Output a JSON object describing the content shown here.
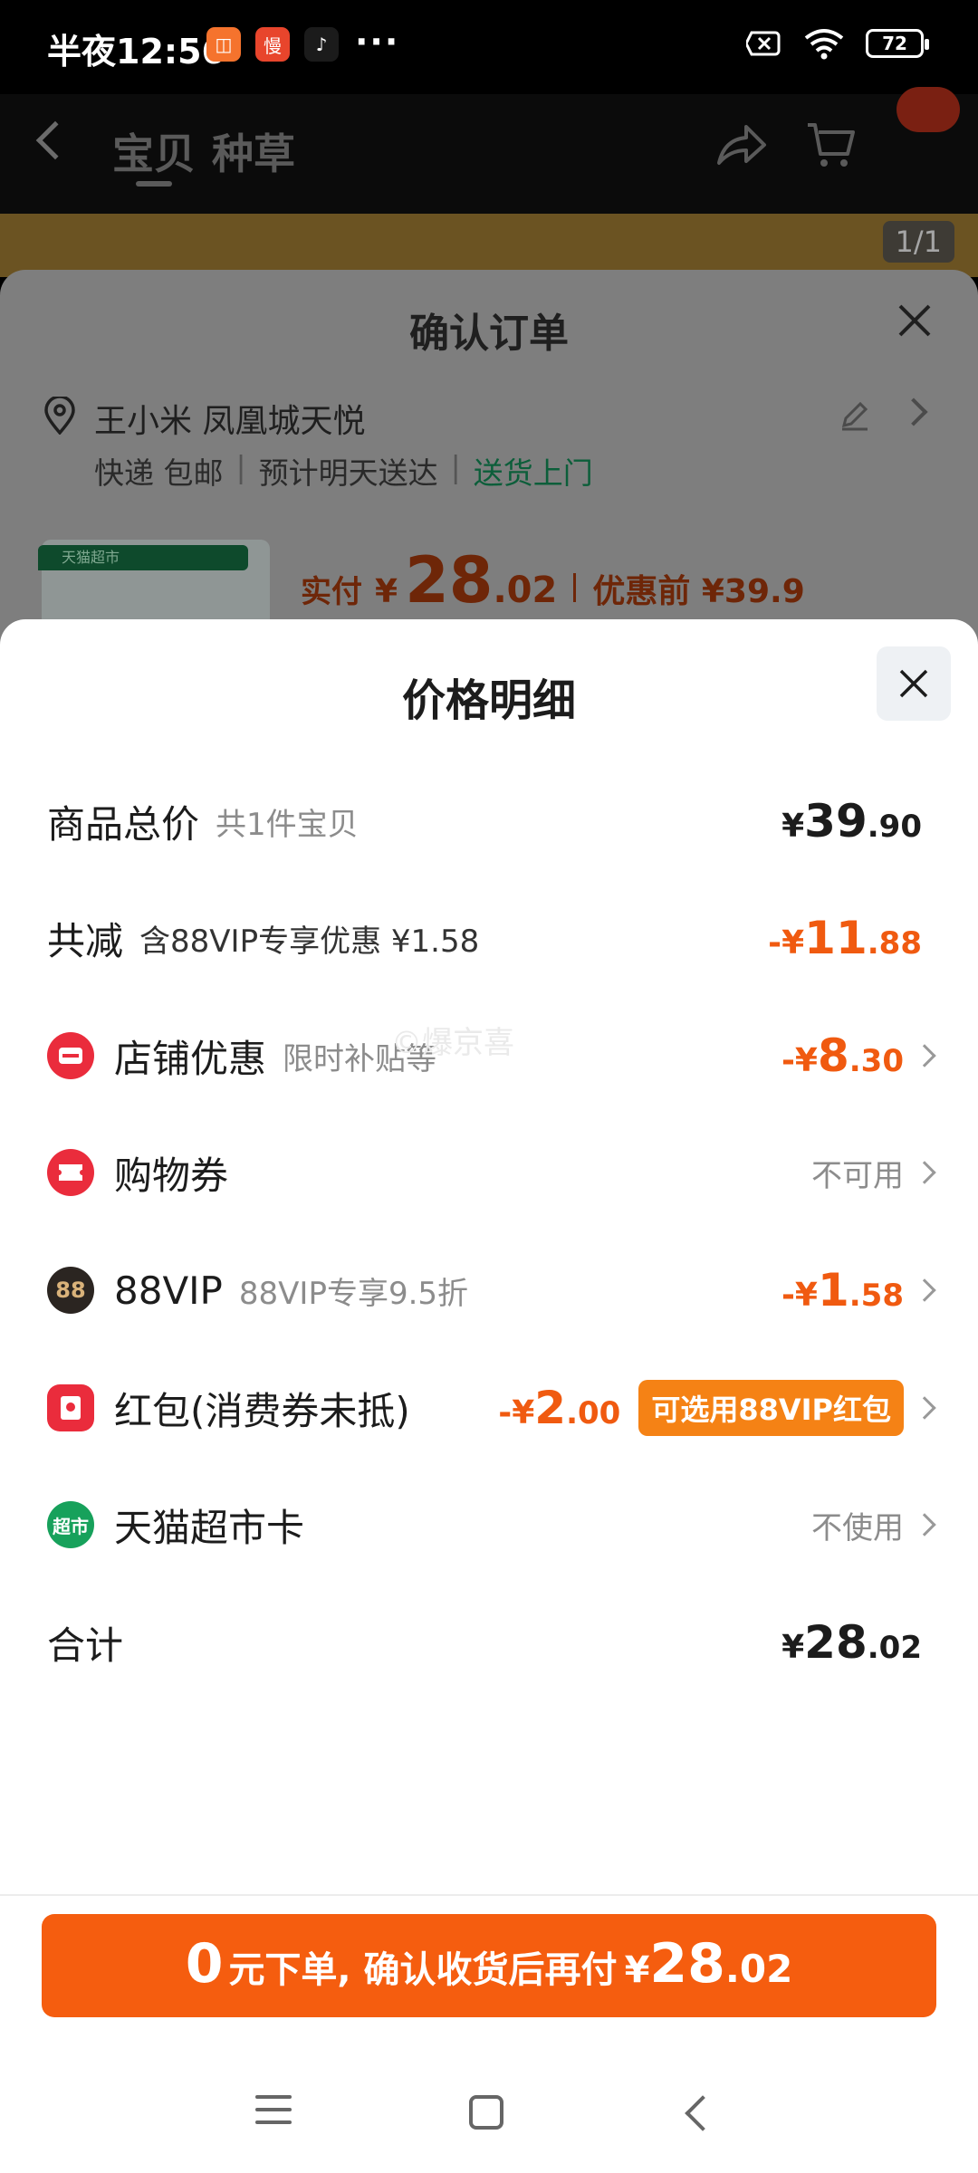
{
  "status_bar": {
    "time": "半夜12:56",
    "apps": [
      {
        "icon": "taobao-icon",
        "glyph": "◫",
        "color": "#f5732d"
      },
      {
        "icon": "xianyu-icon",
        "glyph": "慢",
        "color": "#e8452c"
      },
      {
        "icon": "douyin-icon",
        "glyph": "♪",
        "color": "#1b1b1b"
      }
    ],
    "more": "···",
    "battery": "72"
  },
  "background_page": {
    "tabs": [
      "宝贝",
      "种草"
    ],
    "page_indicator": "1/1",
    "order_sheet": {
      "title": "确认订单",
      "address": "王小米 凤凰城天悦",
      "shipping": [
        "快递 包邮",
        "预计明天送达",
        "送货上门"
      ],
      "product_tag": "天猫超市",
      "pay_label": "实付",
      "pay_currency": "¥",
      "pay_int": "28",
      "pay_dec": ".02",
      "pay_before": "优惠前 ¥39.9"
    }
  },
  "price_detail": {
    "title": "价格明细",
    "rows": [
      {
        "title": "商品总价",
        "sub": "共1件宝贝",
        "amount": {
          "sign": "¥",
          "int": "39",
          "dec": ".90"
        }
      },
      {
        "title": "共减",
        "sub": "含88VIP专享优惠 ¥1.58",
        "amount": {
          "sign": "-¥",
          "int": "11",
          "dec": ".88"
        }
      },
      {
        "title": "店铺优惠",
        "sub": "限时补贴等",
        "amount": {
          "sign": "-¥",
          "int": "8",
          "dec": ".30"
        }
      },
      {
        "title": "购物券",
        "value": "不可用"
      },
      {
        "title": "88VIP",
        "sub": "88VIP专享9.5折",
        "amount": {
          "sign": "-¥",
          "int": "1",
          "dec": ".58"
        }
      },
      {
        "title": "红包(消费券未抵)",
        "amount": {
          "sign": "-¥",
          "int": "2",
          "dec": ".00"
        },
        "badge": "可选用88VIP红包"
      },
      {
        "title": "天猫超市卡",
        "value": "不使用"
      },
      {
        "title": "合计",
        "amount": {
          "sign": "¥",
          "int": "28",
          "dec": ".02"
        }
      }
    ],
    "watermark": "©爆京喜",
    "icon_labels": {
      "vip": "88",
      "tmall_card": "超市"
    }
  },
  "cta": {
    "big": "0",
    "text": "元下单, 确认收货后再付",
    "currency": "¥",
    "int": "28",
    "dec": ".02"
  },
  "colors": {
    "accent": "#f55d0f",
    "discount": "#f05a10",
    "badge": "#f58215",
    "shop_icon": "#ea2c3c",
    "green": "#17a15b"
  }
}
